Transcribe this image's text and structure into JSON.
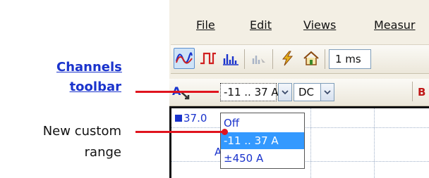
{
  "annotations": {
    "channels_toolbar_line1": "Channels",
    "channels_toolbar_line2": "toolbar",
    "custom_range_line1": "New custom",
    "custom_range_line2": "range"
  },
  "menu": {
    "file": "File",
    "edit": "Edit",
    "views": "Views",
    "measure": "Measur"
  },
  "toolbar": {
    "timebase_value": "1 ms"
  },
  "channels_toolbar": {
    "channel_label": "A",
    "range_value": "-11 .. 37 A",
    "coupling_value": "DC",
    "bandwidth_label": "B"
  },
  "range_dropdown": {
    "options": [
      "Off",
      "-11 .. 37 A",
      "±450 A"
    ],
    "selected_index": 1
  },
  "scope": {
    "axis_top_value": "37.0",
    "axis_unit": "A"
  },
  "colors": {
    "accent_blue": "#1a33cc",
    "callout_red": "#e0141e",
    "selection_blue": "#3399ff",
    "window_bg": "#f3efe4"
  }
}
